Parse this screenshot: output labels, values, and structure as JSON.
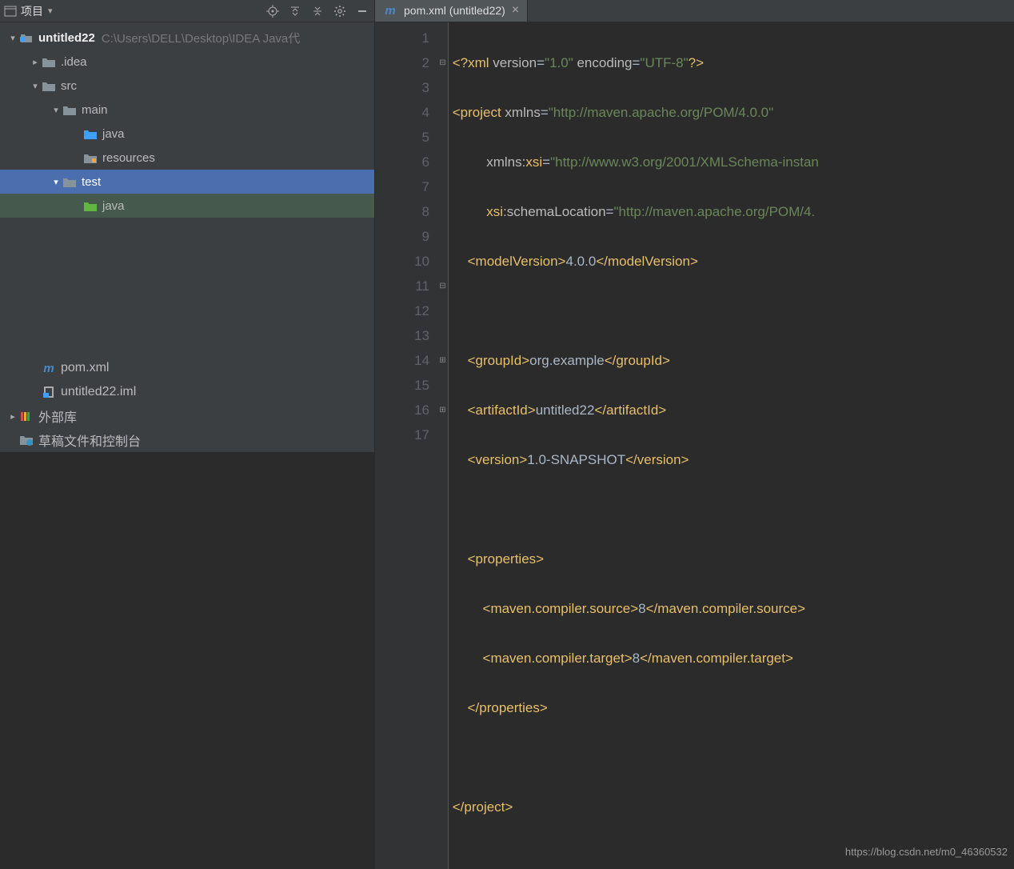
{
  "topbar": {
    "project_label": "项目",
    "dropdown_glyph": "▾"
  },
  "tree": {
    "root": {
      "name": "untitled22",
      "path": "C:\\Users\\DELL\\Desktop\\IDEA Java代"
    },
    "idea": ".idea",
    "src": "src",
    "main": "main",
    "java1": "java",
    "resources": "resources",
    "test": "test",
    "java2": "java",
    "pom": "pom.xml",
    "iml": "untitled22.iml",
    "extlib": "外部库",
    "scratches": "草稿文件和控制台"
  },
  "tab": {
    "title": "pom.xml (untitled22)"
  },
  "gutter": [
    "1",
    "2",
    "3",
    "4",
    "5",
    "6",
    "7",
    "8",
    "9",
    "10",
    "11",
    "12",
    "13",
    "14",
    "15",
    "16",
    "17"
  ],
  "code": {
    "l1": {
      "pi1": "<?xml ",
      "attr1": "version",
      "eq1": "=",
      "str1": "\"1.0\"",
      "sp1": " ",
      "attr2": "encoding",
      "eq2": "=",
      "str2": "\"UTF-8\"",
      "pi2": "?>"
    },
    "l2": {
      "tag1": "<project ",
      "attr1": "xmlns",
      "eq1": "=",
      "str1": "\"http://maven.apache.org/POM/4.0.0\""
    },
    "l3": {
      "attr1": "xmlns:",
      "attr2": "xsi",
      "eq1": "=",
      "str1": "\"http://www.w3.org/2001/XMLSchema-instan"
    },
    "l4": {
      "attr1": "xsi",
      "attr2": ":schemaLocation",
      "eq1": "=",
      "str1": "\"http://maven.apache.org/POM/4."
    },
    "l5": {
      "tag1": "<modelVersion>",
      "txt": "4.0.0",
      "tag2": "</modelVersion>"
    },
    "l7": {
      "tag1": "<groupId>",
      "txt": "org.example",
      "tag2": "</groupId>"
    },
    "l8": {
      "tag1": "<artifactId>",
      "txt": "untitled22",
      "tag2": "</artifactId>"
    },
    "l9": {
      "tag1": "<version>",
      "txt": "1.0-SNAPSHOT",
      "tag2": "</version>"
    },
    "l11": {
      "tag1": "<properties>"
    },
    "l12": {
      "tag1": "<maven.compiler.source>",
      "txt": "8",
      "tag2": "</maven.compiler.source>"
    },
    "l13": {
      "tag1": "<maven.compiler.target>",
      "txt": "8",
      "tag2": "</maven.compiler.target>"
    },
    "l14": {
      "tag1": "</properties>"
    },
    "l16": {
      "tag1": "</project>"
    }
  },
  "watermark": "https://blog.csdn.net/m0_46360532"
}
